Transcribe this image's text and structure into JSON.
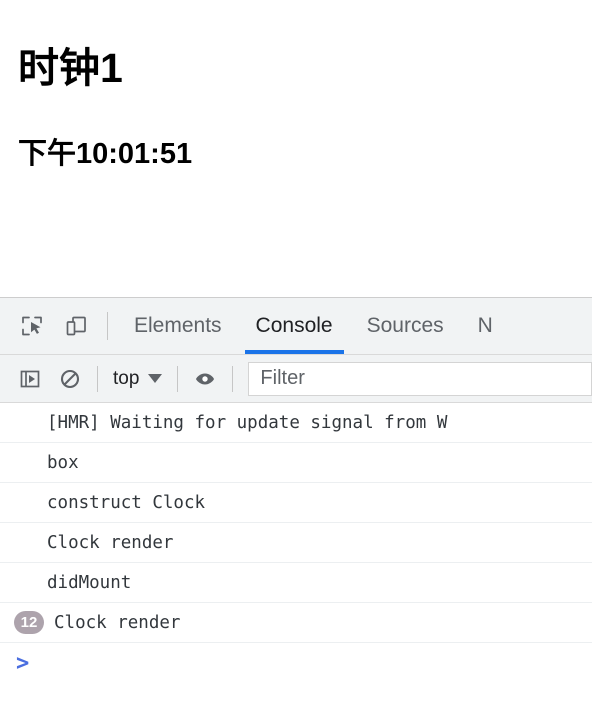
{
  "page": {
    "title": "时钟1",
    "clock": "下午10:01:51"
  },
  "devtools": {
    "toolbar_icons": [
      {
        "name": "inspect-element-icon",
        "label": "inspect-element"
      },
      {
        "name": "device-toolbar-icon",
        "label": "toggle-device-toolbar"
      }
    ],
    "tabs": [
      {
        "label": "Elements",
        "active": false
      },
      {
        "label": "Console",
        "active": true
      },
      {
        "label": "Sources",
        "active": false
      },
      {
        "label": "N",
        "active": false
      }
    ],
    "console_toolbar": {
      "sidebar_icon": "show-console-sidebar-icon",
      "clear_icon": "clear-console-icon",
      "context": "top",
      "eye_icon": "create-live-expression-icon",
      "filter_placeholder": "Filter",
      "filter_value": ""
    },
    "messages": [
      {
        "text": "[HMR] Waiting for update signal from W",
        "indent": true,
        "count": null
      },
      {
        "text": "box",
        "indent": false,
        "count": null
      },
      {
        "text": "construct Clock",
        "indent": false,
        "count": null
      },
      {
        "text": "Clock render",
        "indent": false,
        "count": null
      },
      {
        "text": "didMount",
        "indent": false,
        "count": null
      },
      {
        "text": "Clock render",
        "indent": false,
        "count": "12"
      }
    ],
    "prompt": ">"
  },
  "colors": {
    "accent": "#1a73e8",
    "toolbar_bg": "#f1f3f4",
    "badge_bg": "#ada3ac",
    "prompt_blue": "#4a6ee0",
    "text": "#32373c"
  }
}
